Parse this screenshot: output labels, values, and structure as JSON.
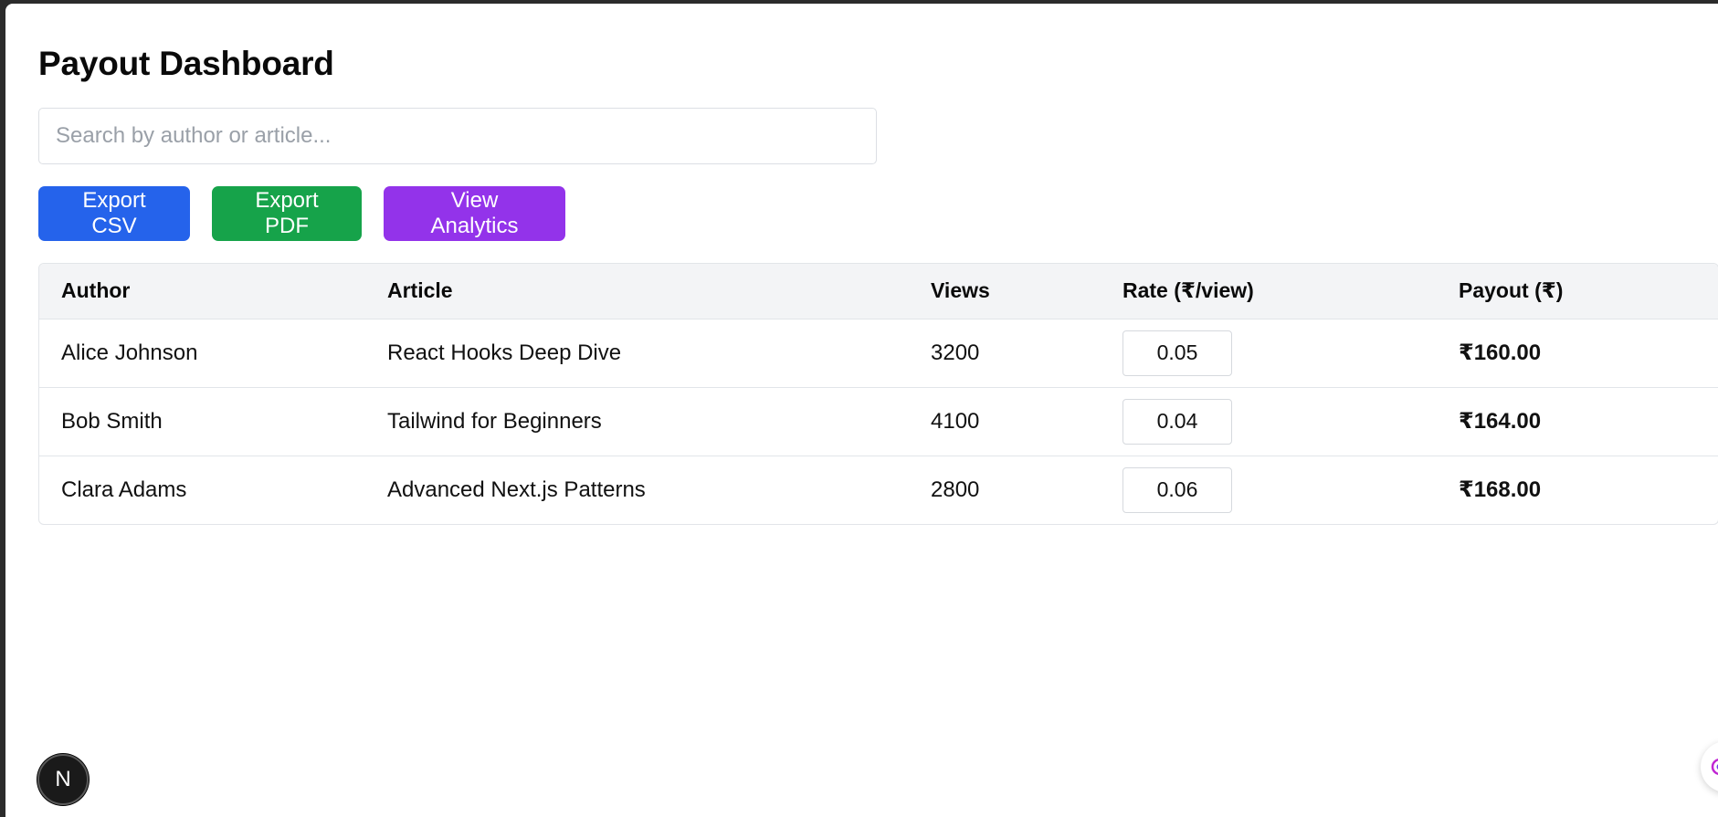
{
  "page": {
    "title": "Payout Dashboard"
  },
  "search": {
    "placeholder": "Search by author or article...",
    "value": ""
  },
  "actions": {
    "export_csv": "Export CSV",
    "export_pdf": "Export PDF",
    "view_analytics": "View Analytics"
  },
  "colors": {
    "export_csv": "#2563eb",
    "export_pdf": "#16a34a",
    "view_analytics": "#9333ea",
    "table_header_bg": "#f3f4f6"
  },
  "table": {
    "columns": [
      "Author",
      "Article",
      "Views",
      "Rate (₹/view)",
      "Payout (₹)"
    ],
    "rows": [
      {
        "author": "Alice Johnson",
        "article": "React Hooks Deep Dive",
        "views": "3200",
        "rate": "0.05",
        "payout": "₹160.00"
      },
      {
        "author": "Bob Smith",
        "article": "Tailwind for Beginners",
        "views": "4100",
        "rate": "0.04",
        "payout": "₹164.00"
      },
      {
        "author": "Clara Adams",
        "article": "Advanced Next.js Patterns",
        "views": "2800",
        "rate": "0.06",
        "payout": "₹168.00"
      }
    ]
  },
  "overlay": {
    "next_badge": "N",
    "floating_tool_icon": "devtools-icon"
  }
}
